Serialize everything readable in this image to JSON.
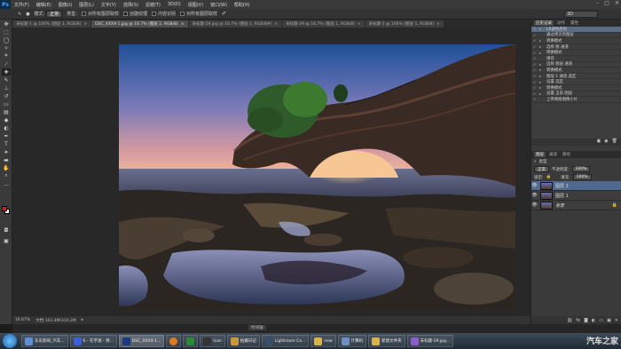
{
  "app": {
    "logo": "Ps"
  },
  "menu": [
    "文件(F)",
    "编辑(E)",
    "图像(I)",
    "图层(L)",
    "文字(Y)",
    "选择(S)",
    "滤镜(T)",
    "3D(D)",
    "视图(V)",
    "窗口(W)",
    "帮助(H)"
  ],
  "window_controls": [
    "–",
    "□",
    "✕"
  ],
  "options": {
    "mode_label": "模式:",
    "mode_value": "正常",
    "type_label": "类型:",
    "sample_all": "对所有图层取样",
    "create_texture": "创建纹理",
    "content_aware": "内容识别",
    "sample_all_layers": "对所有图层取样",
    "workspace": "3D"
  },
  "tabs": [
    {
      "label": "未标题-1 @ 100% (图层 1, RGB/8)",
      "active": false
    },
    {
      "label": "DSC_XXXX-1.jpg @ 16.7% (图层 2, RGB/8)",
      "active": true
    },
    {
      "label": "未标题-29.jpg @ 16.7% (图层 2, RGB/8#)",
      "active": false
    },
    {
      "label": "未标题-29 @ 16.7% (图层 1, RGB/8)",
      "active": false
    },
    {
      "label": "未标题-1 @ 100% (图层 1, RGB/8)",
      "active": false
    }
  ],
  "status": {
    "zoom": "16.67%",
    "doc": "文档:103.4M/310.2M"
  },
  "timeline_label": "时间轴",
  "panels": {
    "top_tabs": [
      "历史记录",
      "动作",
      "属性"
    ],
    "history": [
      {
        "label": "LR调色后的",
        "sel": true
      },
      {
        "label": "通过拷贝的图层",
        "sel": false
      },
      {
        "label": "转换模式",
        "sel": false
      },
      {
        "label": "选择 图 通道",
        "sel": false
      },
      {
        "label": "转换模式",
        "sel": false
      },
      {
        "label": "填充",
        "sel": false
      },
      {
        "label": "选择 图层 通道",
        "sel": false
      },
      {
        "label": "转换模式",
        "sel": false
      },
      {
        "label": "图层 1 通道 选区",
        "sel": false
      },
      {
        "label": "设置 选区",
        "sel": false
      },
      {
        "label": "转换模式",
        "sel": false
      },
      {
        "label": "设置 当前 图层",
        "sel": false
      },
      {
        "label": "上传网络图像小片",
        "sel": false
      }
    ],
    "layer_tabs": [
      "图层",
      "通道",
      "路径"
    ],
    "blend_mode": "正常",
    "opacity_label": "不透明度:",
    "opacity": "100%",
    "lock_label": "锁定:",
    "fill_label": "填充:",
    "fill": "100%",
    "kind_label": "类型",
    "layers": [
      {
        "name": "图层 2",
        "sel": true
      },
      {
        "name": "图层 1",
        "sel": false
      },
      {
        "name": "背景",
        "sel": false
      }
    ]
  },
  "taskbar": {
    "items": [
      {
        "label": "东东影响_汽车...",
        "color": "#5d8fd6"
      },
      {
        "label": "K - 在字源 - 预...",
        "color": "#3b5fd6"
      },
      {
        "label": "DSC_XXXX-1...",
        "color": "#1a3a7a"
      },
      {
        "label": "",
        "color": "#e07a1e"
      },
      {
        "label": "",
        "color": "#2a8a3a"
      },
      {
        "label": "Ican",
        "color": "#333333"
      },
      {
        "label": "拍摄日记",
        "color": "#c89a3a"
      },
      {
        "label": "Lightroom Ca...",
        "color": "#3a4f66"
      },
      {
        "label": "new",
        "color": "#d8b24a"
      },
      {
        "label": "计算机",
        "color": "#6a8fc0"
      },
      {
        "label": "新建文件夹",
        "color": "#d8b24a"
      },
      {
        "label": "未标题-29.jpg...",
        "color": "#8a5ec8"
      }
    ],
    "tray_text": "汽车之家"
  }
}
